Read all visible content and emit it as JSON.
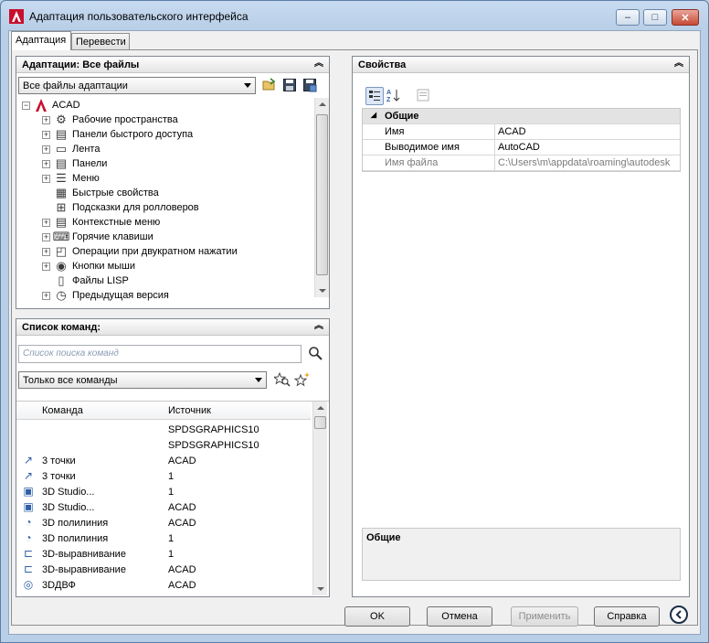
{
  "window": {
    "title": "Адаптация пользовательского интерфейса",
    "minimize": "–",
    "restore": "□",
    "close": "✕"
  },
  "tabs": [
    {
      "label": "Адаптация"
    },
    {
      "label": "Перевести"
    }
  ],
  "customizations_panel": {
    "title": "Адаптации: Все файлы",
    "filter_value": "Все файлы адаптации",
    "tree": [
      {
        "label": "ACAD",
        "icon": "acad-logo-icon"
      },
      {
        "label": "Рабочие пространства",
        "icon": "gear-icon"
      },
      {
        "label": "Панели быстрого доступа",
        "icon": "toolbar-icon"
      },
      {
        "label": "Лента",
        "icon": "ribbon-icon"
      },
      {
        "label": "Панели",
        "icon": "toolbar-icon"
      },
      {
        "label": "Меню",
        "icon": "menu-icon"
      },
      {
        "label": "Быстрые свойства",
        "icon": "quick-properties-icon"
      },
      {
        "label": "Подсказки для ролловеров",
        "icon": "rollover-tooltip-icon"
      },
      {
        "label": "Контекстные меню",
        "icon": "shortcut-menu-icon"
      },
      {
        "label": "Горячие клавиши",
        "icon": "keyboard-icon"
      },
      {
        "label": "Операции при двукратном нажатии",
        "icon": "double-click-icon"
      },
      {
        "label": "Кнопки мыши",
        "icon": "mouse-icon"
      },
      {
        "label": "Файлы LISP",
        "icon": "lisp-file-icon"
      },
      {
        "label": "Предыдущая версия",
        "icon": "clock-icon"
      }
    ]
  },
  "commands_panel": {
    "title": "Список команд:",
    "search_placeholder": "Список поиска команд",
    "filter_value": "Только все команды",
    "columns": [
      "Команда",
      "Источник"
    ],
    "rows": [
      {
        "name": "",
        "source": "SPDSGRAPHICS10",
        "icon": ""
      },
      {
        "name": "",
        "source": "SPDSGRAPHICS10",
        "icon": ""
      },
      {
        "name": "3 точки",
        "source": "ACAD",
        "icon": "3point-icon"
      },
      {
        "name": "3 точки",
        "source": "1",
        "icon": "3point-icon"
      },
      {
        "name": "3D Studio...",
        "source": "1",
        "icon": "3ds-icon"
      },
      {
        "name": "3D Studio...",
        "source": "ACAD",
        "icon": "3ds-icon"
      },
      {
        "name": "3D полилиния",
        "source": "ACAD",
        "icon": "3dpoly-icon"
      },
      {
        "name": "3D полилиния",
        "source": "1",
        "icon": "3dpoly-icon"
      },
      {
        "name": "3D-выравнивание",
        "source": "1",
        "icon": "3dalign-icon"
      },
      {
        "name": "3D-выравнивание",
        "source": "ACAD",
        "icon": "3dalign-icon"
      },
      {
        "name": "3DДВФ",
        "source": "ACAD",
        "icon": "3ddwf-icon"
      }
    ]
  },
  "properties_panel": {
    "title": "Свойства",
    "group": "Общие",
    "rows": [
      {
        "key": "Имя",
        "value": "ACAD",
        "disabled": false
      },
      {
        "key": "Выводимое имя",
        "value": "AutoCAD",
        "disabled": false
      },
      {
        "key": "Имя файла",
        "value": "C:\\Users\\m\\appdata\\roaming\\autodesk",
        "disabled": true
      }
    ],
    "description_title": "Общие"
  },
  "buttons": {
    "ok": "OK",
    "cancel": "Отмена",
    "apply": "Применить",
    "help": "Справка"
  },
  "colors": {
    "title_bg": "#c7daf0",
    "acad_red": "#c8102e",
    "accent_blue": "#2f5fa8"
  }
}
